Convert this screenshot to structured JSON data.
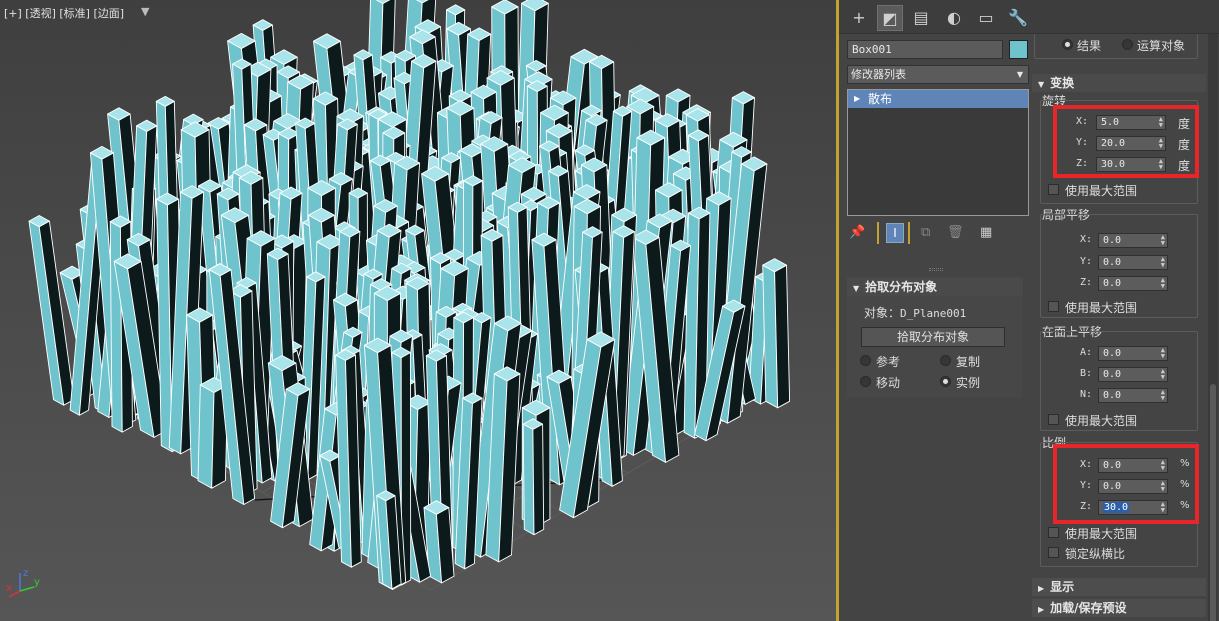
{
  "viewport": {
    "label": "[+] [透视] [标准] [边面]",
    "filter_icon": "filter-icon",
    "axis_x": "x",
    "axis_y": "y",
    "axis_z": "z",
    "object_color": "#6fc3cc",
    "selection_color": "#c7a032"
  },
  "panel": {
    "tabs": [
      {
        "icon": "plus-icon",
        "glyph": "+"
      },
      {
        "icon": "modify-icon",
        "glyph": "◩"
      },
      {
        "icon": "hierarchy-icon",
        "glyph": "▤"
      },
      {
        "icon": "motion-icon",
        "glyph": "◐"
      },
      {
        "icon": "display-icon",
        "glyph": "▭"
      },
      {
        "icon": "utilities-icon",
        "glyph": "🔧"
      }
    ],
    "object_name": "Box001",
    "object_color": "#6fc3cc",
    "modifier_list": "修改器列表",
    "stack_item": "散布",
    "pick_rollout": {
      "title": "拾取分布对象",
      "object_label": "对象：",
      "object_value": "D_Plane001",
      "pick_button": "拾取分布对象",
      "reference": "参考",
      "copy": "复制",
      "move": "移动",
      "instance": "实例"
    },
    "result": "结果",
    "operand": "运算对象",
    "transform": {
      "title": "变换",
      "rotation_label": "旋转",
      "rotation": [
        {
          "axis": "X:",
          "value": "5.0",
          "unit": "度"
        },
        {
          "axis": "Y:",
          "value": "20.0",
          "unit": "度"
        },
        {
          "axis": "Z:",
          "value": "30.0",
          "unit": "度"
        }
      ],
      "use_max_range": "使用最大范围",
      "local_translate_label": "局部平移",
      "local_translate": [
        {
          "axis": "X:",
          "value": "0.0"
        },
        {
          "axis": "Y:",
          "value": "0.0"
        },
        {
          "axis": "Z:",
          "value": "0.0"
        }
      ],
      "face_translate_label": "在面上平移",
      "face_translate": [
        {
          "axis": "A:",
          "value": "0.0"
        },
        {
          "axis": "B:",
          "value": "0.0"
        },
        {
          "axis": "N:",
          "value": "0.0"
        }
      ],
      "scale_label": "比例",
      "scale": [
        {
          "axis": "X:",
          "value": "0.0",
          "unit": "%"
        },
        {
          "axis": "Y:",
          "value": "0.0",
          "unit": "%"
        },
        {
          "axis": "Z:",
          "value": "30.0",
          "unit": "%"
        }
      ],
      "lock_aspect": "锁定纵横比"
    },
    "display_rollout": "显示",
    "load_save_rollout": "加载/保存预设"
  },
  "colors": {
    "highlight": "#e8262a",
    "stack_selected": "#5e84b8"
  }
}
